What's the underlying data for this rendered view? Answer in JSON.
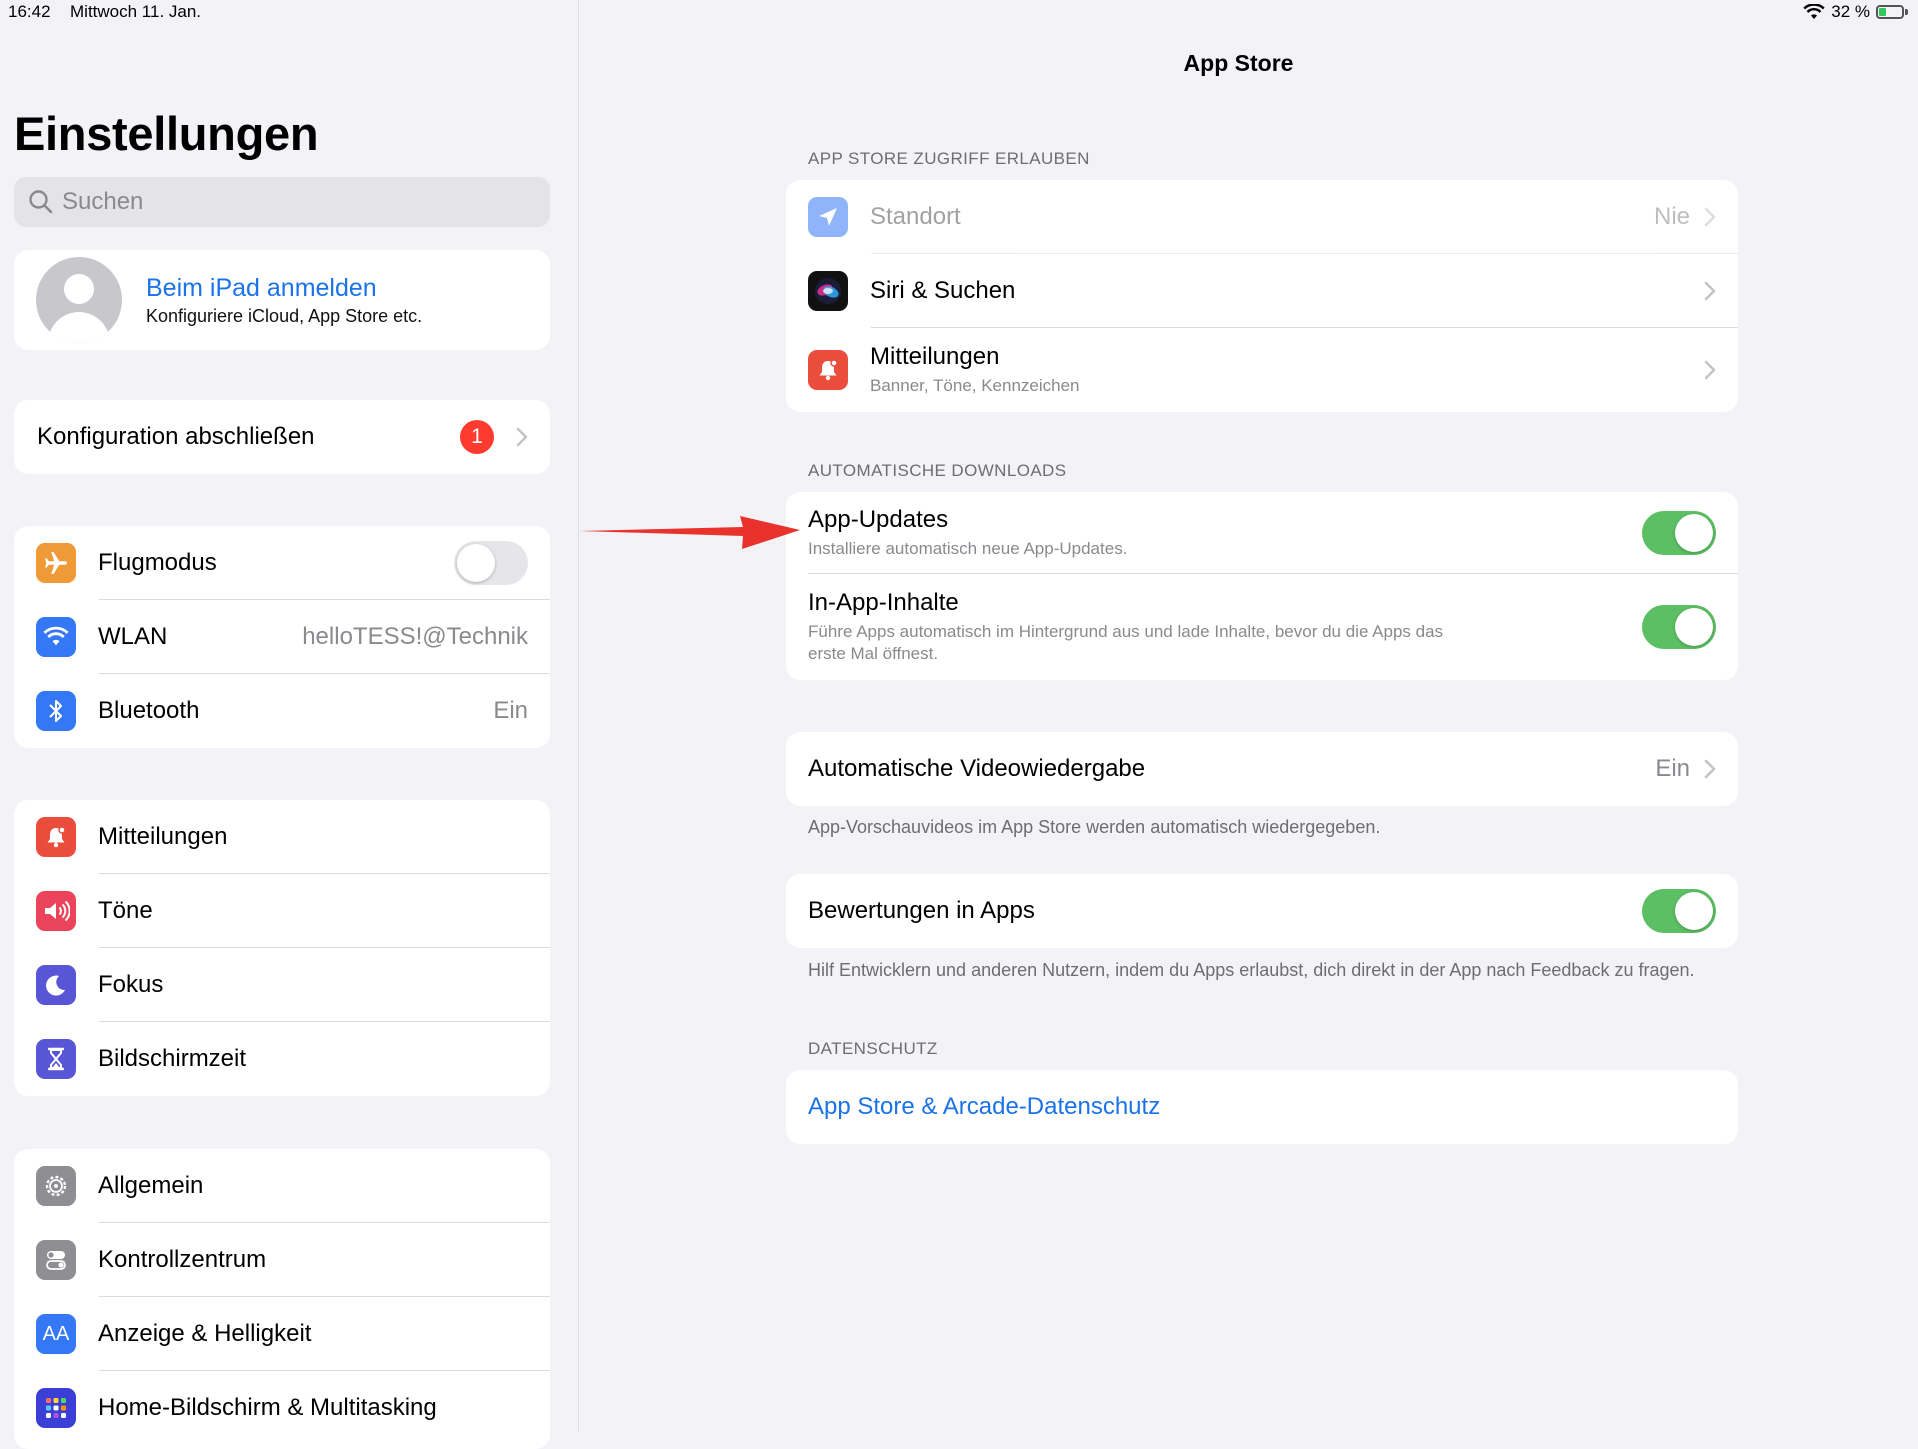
{
  "status_bar": {
    "time": "16:42",
    "date": "Mittwoch 11. Jan.",
    "battery_text": "32 %"
  },
  "sidebar": {
    "title": "Einstellungen",
    "search_placeholder": "Suchen",
    "profile": {
      "name": "Beim iPad anmelden",
      "subtitle": "Konfiguriere iCloud, App Store etc."
    },
    "config": {
      "label": "Konfiguration abschließen",
      "badge": "1"
    },
    "group1": [
      {
        "label": "Flugmodus",
        "icon": "airplane-icon",
        "color": "#f09a37",
        "toggle": false
      },
      {
        "label": "WLAN",
        "icon": "wifi-icon",
        "color": "#3478f6",
        "value": "helloTESS!@Technik"
      },
      {
        "label": "Bluetooth",
        "icon": "bluetooth-icon",
        "color": "#3478f6",
        "value": "Ein"
      }
    ],
    "group2": [
      {
        "label": "Mitteilungen",
        "icon": "notification-icon",
        "color": "#eb4d3d"
      },
      {
        "label": "Töne",
        "icon": "speaker-icon",
        "color": "#eb445a"
      },
      {
        "label": "Fokus",
        "icon": "moon-icon",
        "color": "#5856d6"
      },
      {
        "label": "Bildschirmzeit",
        "icon": "hourglass-icon",
        "color": "#5856d6"
      }
    ],
    "group3": [
      {
        "label": "Allgemein",
        "icon": "gear-icon",
        "color": "#8e8e93"
      },
      {
        "label": "Kontrollzentrum",
        "icon": "switches-icon",
        "color": "#8e8e93"
      },
      {
        "label": "Anzeige & Helligkeit",
        "icon": "aa-icon",
        "color": "#3478f6",
        "icon_text": "AA"
      },
      {
        "label": "Home-Bildschirm & Multitasking",
        "icon": "grid-icon",
        "color": "#3b3fd6"
      }
    ]
  },
  "main": {
    "title": "App Store",
    "access": {
      "header": "APP STORE ZUGRIFF ERLAUBEN",
      "rows": [
        {
          "label": "Standort",
          "value": "Nie",
          "icon": "location-arrow-icon"
        },
        {
          "label": "Siri & Suchen",
          "icon": "siri-icon"
        },
        {
          "label": "Mitteilungen",
          "subtitle": "Banner, Töne, Kennzeichen",
          "icon": "notification-icon"
        }
      ]
    },
    "downloads": {
      "header": "AUTOMATISCHE DOWNLOADS",
      "rows": [
        {
          "label": "App-Updates",
          "subtitle": "Installiere automatisch neue App-Updates.",
          "toggle": true
        },
        {
          "label": "In-App-Inhalte",
          "subtitle": "Führe Apps automatisch im Hintergrund aus und lade Inhalte, bevor du die Apps das erste Mal öffnest.",
          "toggle": true
        }
      ]
    },
    "video": {
      "label": "Automatische Videowiedergabe",
      "value": "Ein",
      "footnote": "App-Vorschauvideos im App Store werden automatisch wiedergegeben."
    },
    "ratings": {
      "label": "Bewertungen in Apps",
      "toggle": true,
      "footnote": "Hilf Entwicklern und anderen Nutzern, indem du Apps erlaubst, dich direkt in der App nach Feedback zu fragen."
    },
    "privacy": {
      "header": "DATENSCHUTZ",
      "link": "App Store & Arcade-Datenschutz"
    }
  },
  "colors": {
    "accent": "#1a73e8",
    "toggle_on": "#5cbf63",
    "badge": "#ff3b30",
    "annotation_arrow": "#e8322b"
  }
}
